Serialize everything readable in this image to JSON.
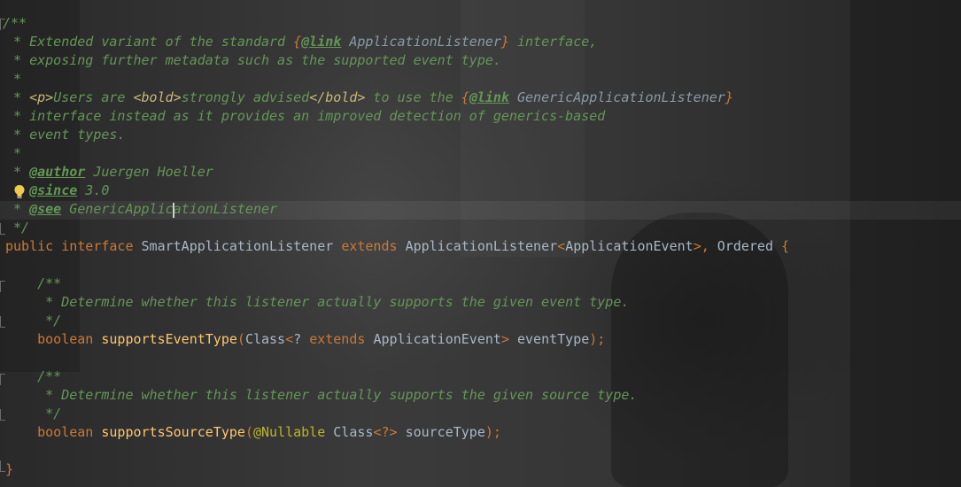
{
  "code": {
    "l1": "/**",
    "l2_a": " * Extended variant of the standard ",
    "l2_b": "{",
    "l2_c": "@link",
    "l2_d": " ApplicationListener",
    "l2_e": "}",
    "l2_f": " interface,",
    "l3": " * exposing further metadata such as the supported event type.",
    "l4": " *",
    "l5_a": " * ",
    "l5_b": "<p>",
    "l5_c": "Users are ",
    "l5_d": "<bold>",
    "l5_e": "strongly advised",
    "l5_f": "</bold>",
    "l5_g": " to use the ",
    "l5_h": "{",
    "l5_i": "@link",
    "l5_j": " GenericApplicationListener",
    "l5_k": "}",
    "l6": " * interface instead as it provides an improved detection of generics-based",
    "l7": " * event types.",
    "l8": " *",
    "l9_a": " * ",
    "l9_b": "@author",
    "l9_c": " Juergen Hoeller",
    "l10_a": " * ",
    "l10_b": "@since",
    "l10_c": " 3.0",
    "l11_a": " * ",
    "l11_b": "@see",
    "l11_c": " GenericApplicationListener",
    "l12": " */",
    "l13_public": "public",
    "l13_interface": "interface",
    "l13_name": "SmartApplicationListener",
    "l13_extends": "extends",
    "l13_parent": "ApplicationListener",
    "l13_lt": "<",
    "l13_generic": "ApplicationEvent",
    "l13_gt": ">",
    "l13_comma": ",",
    "l13_ordered": "Ordered",
    "l13_brace": "{",
    "l15": "    /**",
    "l16": "     * Determine whether this listener actually supports the given event type.",
    "l17": "     */",
    "l18_boolean": "boolean",
    "l18_method": "supportsEventType",
    "l18_paren": "(",
    "l18_class": "Class",
    "l18_lt": "<",
    "l18_q": "?",
    "l18_extends": "extends",
    "l18_type": "ApplicationEvent",
    "l18_gt": ">",
    "l18_param": "eventType",
    "l18_end": ");",
    "l20": "    /**",
    "l21": "     * Determine whether this listener actually supports the given source type.",
    "l22": "     */",
    "l23_boolean": "boolean",
    "l23_method": "supportsSourceType",
    "l23_paren": "(",
    "l23_ann": "@Nullable",
    "l23_class": "Class",
    "l23_generic": "<?>",
    "l23_param": "sourceType",
    "l23_end": ");",
    "l25": "}"
  },
  "icons": {
    "intention": "lightbulb-icon",
    "fold": "fold-marker-icon"
  },
  "colors": {
    "comment": "#629755",
    "keyword": "#cc7832",
    "method": "#ffc66d",
    "annotation": "#bbb529",
    "identifier": "#a9b7c6",
    "html_tag": "#c9b876"
  }
}
